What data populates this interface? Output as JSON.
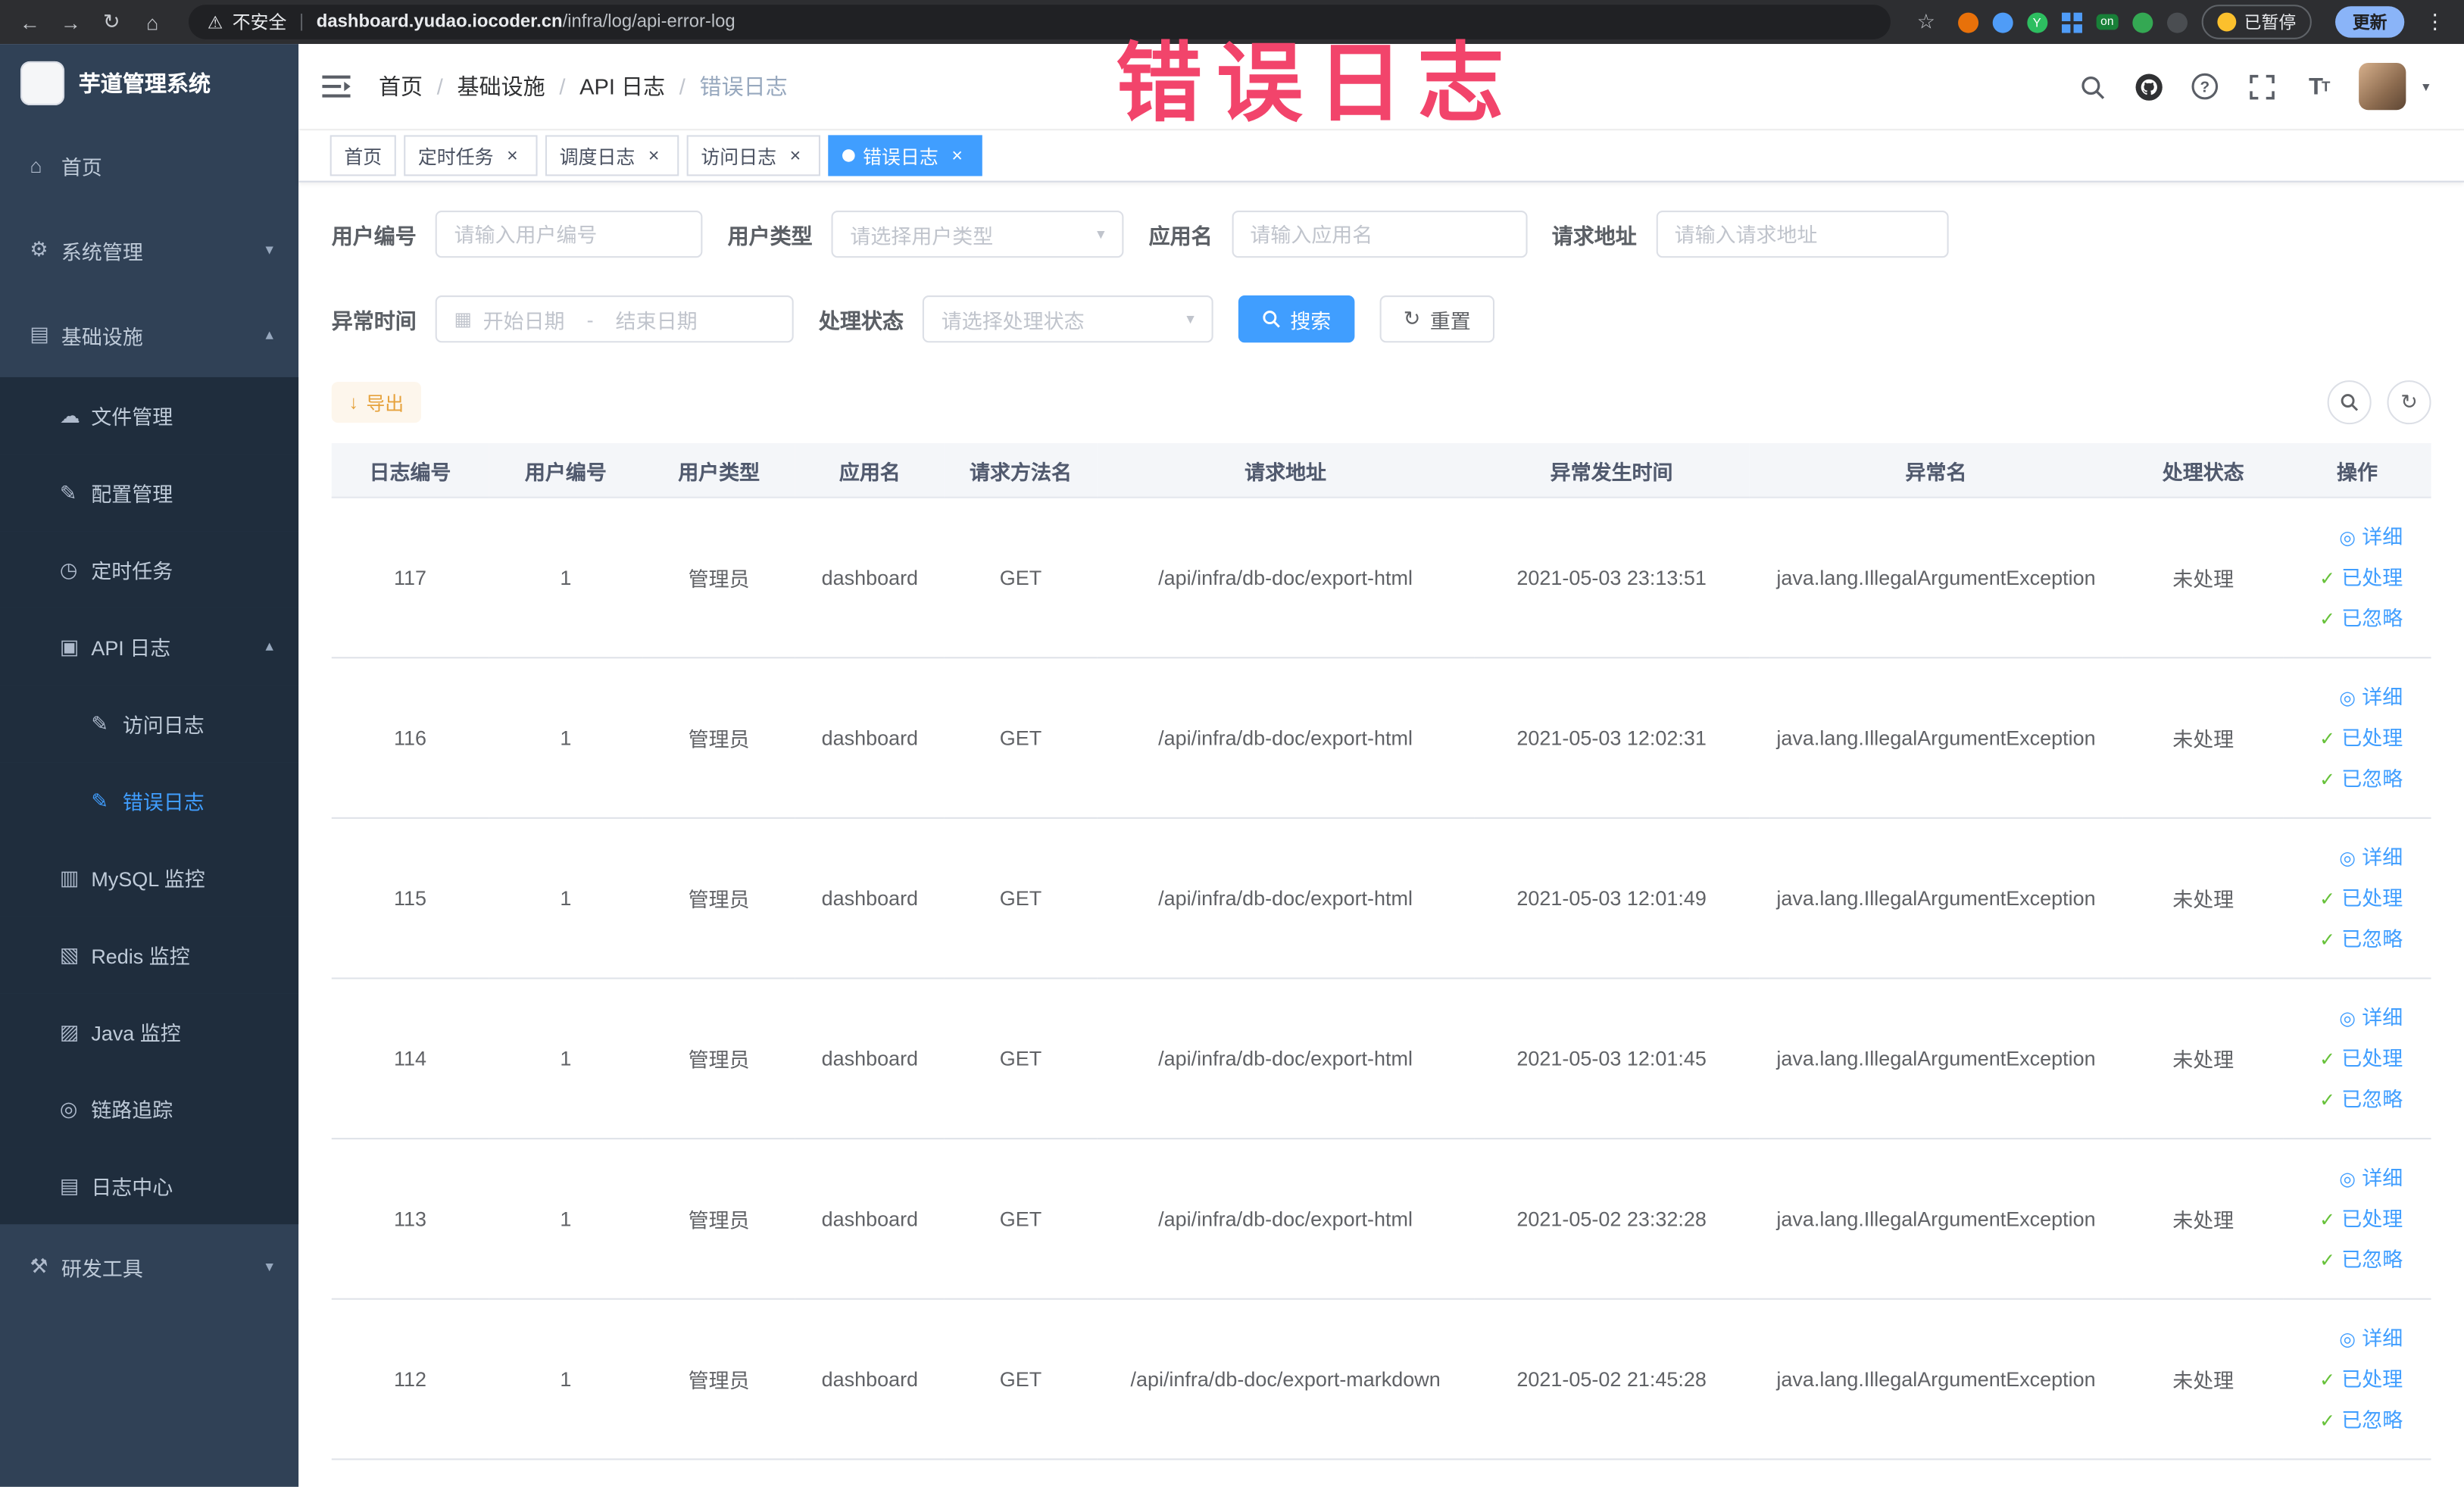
{
  "annotation": {
    "text": "错误日志"
  },
  "browser": {
    "security_label": "不安全",
    "url_host": "dashboard.yudao.iocoder.cn",
    "url_path": "/infra/log/api-error-log",
    "ext_badge_on": "on",
    "paused_label": "已暂停",
    "update_label": "更新"
  },
  "sidebar": {
    "logo_title": "芋道管理系统",
    "items": [
      {
        "label": "首页"
      },
      {
        "label": "系统管理"
      },
      {
        "label": "基础设施"
      },
      {
        "label": "文件管理"
      },
      {
        "label": "配置管理"
      },
      {
        "label": "定时任务"
      },
      {
        "label": "API 日志"
      },
      {
        "label": "访问日志"
      },
      {
        "label": "错误日志"
      },
      {
        "label": "MySQL 监控"
      },
      {
        "label": "Redis 监控"
      },
      {
        "label": "Java 监控"
      },
      {
        "label": "链路追踪"
      },
      {
        "label": "日志中心"
      },
      {
        "label": "研发工具"
      }
    ]
  },
  "header": {
    "breadcrumb": [
      "首页",
      "基础设施",
      "API 日志",
      "错误日志"
    ],
    "separator": "/"
  },
  "tabs": [
    {
      "label": "首页"
    },
    {
      "label": "定时任务"
    },
    {
      "label": "调度日志"
    },
    {
      "label": "访问日志"
    },
    {
      "label": "错误日志"
    }
  ],
  "filters": {
    "user_id_label": "用户编号",
    "user_id_placeholder": "请输入用户编号",
    "user_type_label": "用户类型",
    "user_type_placeholder": "请选择用户类型",
    "app_name_label": "应用名",
    "app_name_placeholder": "请输入应用名",
    "request_url_label": "请求地址",
    "request_url_placeholder": "请输入请求地址",
    "exception_time_label": "异常时间",
    "date_start_placeholder": "开始日期",
    "date_separator": "-",
    "date_end_placeholder": "结束日期",
    "process_status_label": "处理状态",
    "process_status_placeholder": "请选择处理状态",
    "search_button": "搜索",
    "reset_button": "重置"
  },
  "toolbar": {
    "export_button": "导出"
  },
  "table": {
    "columns": [
      "日志编号",
      "用户编号",
      "用户类型",
      "应用名",
      "请求方法名",
      "请求地址",
      "异常发生时间",
      "异常名",
      "处理状态",
      "操作"
    ],
    "action_labels": {
      "detail": "详细",
      "processed": "已处理",
      "ignored": "已忽略"
    },
    "rows": [
      {
        "id": "117",
        "user_id": "1",
        "user_type": "管理员",
        "app": "dashboard",
        "method": "GET",
        "url": "/api/infra/db-doc/export-html",
        "time": "2021-05-03 23:13:51",
        "exception": "java.lang.IllegalArgumentException",
        "status": "未处理"
      },
      {
        "id": "116",
        "user_id": "1",
        "user_type": "管理员",
        "app": "dashboard",
        "method": "GET",
        "url": "/api/infra/db-doc/export-html",
        "time": "2021-05-03 12:02:31",
        "exception": "java.lang.IllegalArgumentException",
        "status": "未处理"
      },
      {
        "id": "115",
        "user_id": "1",
        "user_type": "管理员",
        "app": "dashboard",
        "method": "GET",
        "url": "/api/infra/db-doc/export-html",
        "time": "2021-05-03 12:01:49",
        "exception": "java.lang.IllegalArgumentException",
        "status": "未处理"
      },
      {
        "id": "114",
        "user_id": "1",
        "user_type": "管理员",
        "app": "dashboard",
        "method": "GET",
        "url": "/api/infra/db-doc/export-html",
        "time": "2021-05-03 12:01:45",
        "exception": "java.lang.IllegalArgumentException",
        "status": "未处理"
      },
      {
        "id": "113",
        "user_id": "1",
        "user_type": "管理员",
        "app": "dashboard",
        "method": "GET",
        "url": "/api/infra/db-doc/export-html",
        "time": "2021-05-02 23:32:28",
        "exception": "java.lang.IllegalArgumentException",
        "status": "未处理"
      },
      {
        "id": "112",
        "user_id": "1",
        "user_type": "管理员",
        "app": "dashboard",
        "method": "GET",
        "url": "/api/infra/db-doc/export-markdown",
        "time": "2021-05-02 21:45:28",
        "exception": "java.lang.IllegalArgumentException",
        "status": "未处理"
      }
    ]
  }
}
